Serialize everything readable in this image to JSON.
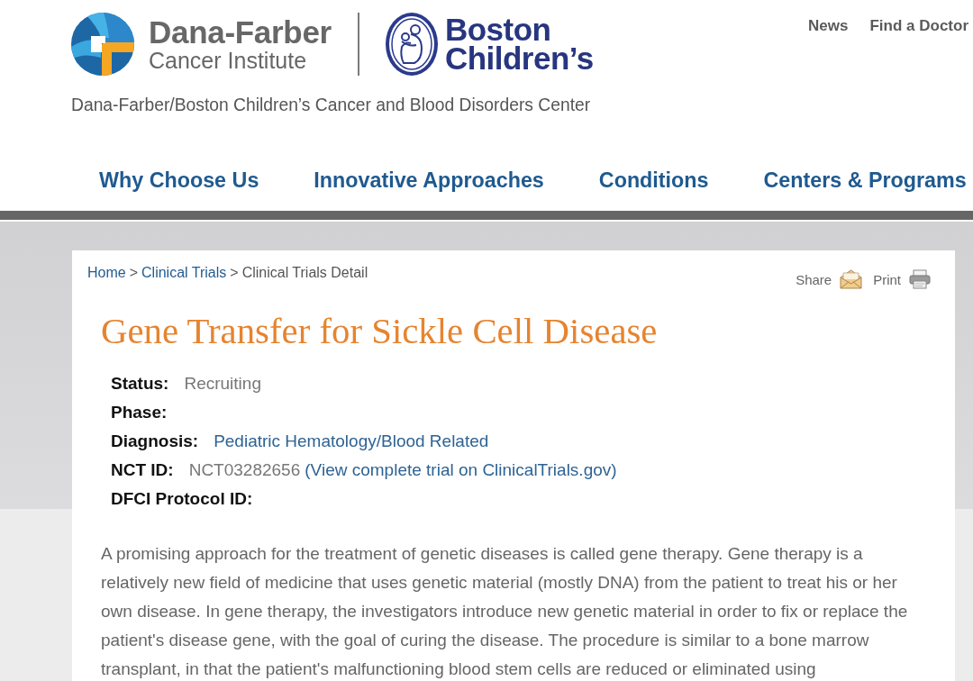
{
  "header": {
    "dana_farber_logo": {
      "title": "Dana-Farber",
      "subtitle": "Cancer Institute"
    },
    "boston_childrens_logo": {
      "lines": [
        "Boston",
        "Children’s"
      ]
    },
    "center_name": "Dana-Farber/Boston Children’s Cancer and Blood Disorders Center",
    "utility_links": [
      "News",
      "Find a Doctor"
    ]
  },
  "main_nav": [
    "Why Choose Us",
    "Innovative Approaches",
    "Conditions",
    "Centers & Programs"
  ],
  "breadcrumb": {
    "separator": ">",
    "items": [
      {
        "label": "Home",
        "kind": "link"
      },
      {
        "label": "Clinical Trials",
        "kind": "link"
      },
      {
        "label": "Clinical Trials Detail",
        "kind": "current"
      }
    ]
  },
  "actions": [
    {
      "label": "Share",
      "kind": "share"
    },
    {
      "label": "Print",
      "kind": "print"
    }
  ],
  "trial": {
    "title": "Gene Transfer for Sickle Cell Disease",
    "details": [
      {
        "label": "Status:",
        "value": "Recruiting",
        "kind": "text"
      },
      {
        "label": "Phase:"
      },
      {
        "label": "Diagnosis:",
        "value": "Pediatric Hematology/Blood Related",
        "kind": "link"
      },
      {
        "label": "NCT ID:",
        "value": "NCT03282656",
        "kind": "text",
        "link": "(View complete trial on ClinicalTrials.gov)"
      },
      {
        "label": "DFCI Protocol ID:"
      }
    ],
    "description": "A promising approach for the treatment of genetic diseases is called gene therapy. Gene therapy is a relatively new field of medicine that uses genetic material (mostly DNA) from the patient to treat his or her own disease. In gene therapy, the investigators introduce new genetic material in order to fix or replace the patient's disease gene, with the goal of curing the disease. The procedure is similar to a bone marrow transplant, in that the patient's malfunctioning blood stem cells are reduced or eliminated using"
  }
}
